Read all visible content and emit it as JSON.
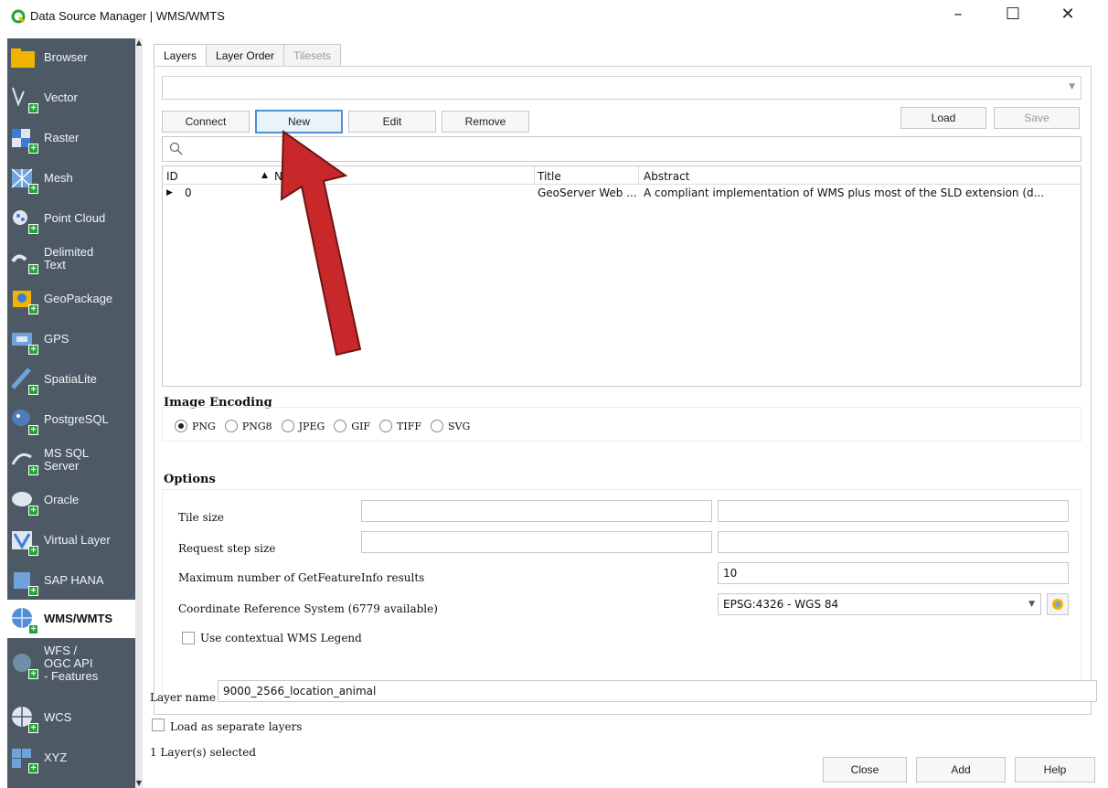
{
  "window": {
    "title": "Data Source Manager | WMS/WMTS",
    "min_glyph": "–",
    "max_glyph": "☐",
    "close_glyph": "✕"
  },
  "sidebar": {
    "items": [
      {
        "label": "Browser",
        "icon": "browser-folder-icon"
      },
      {
        "label": "Vector",
        "icon": "vector-layer-icon"
      },
      {
        "label": "Raster",
        "icon": "raster-layer-icon"
      },
      {
        "label": "Mesh",
        "icon": "mesh-layer-icon"
      },
      {
        "label": "Point Cloud",
        "icon": "point-cloud-icon"
      },
      {
        "label": "Delimited Text",
        "icon": "delimited-text-icon"
      },
      {
        "label": "GeoPackage",
        "icon": "geopackage-icon"
      },
      {
        "label": "GPS",
        "icon": "gps-icon"
      },
      {
        "label": "SpatiaLite",
        "icon": "spatialite-icon"
      },
      {
        "label": "PostgreSQL",
        "icon": "postgresql-icon"
      },
      {
        "label": "MS SQL Server",
        "icon": "mssql-icon"
      },
      {
        "label": "Oracle",
        "icon": "oracle-icon"
      },
      {
        "label": "Virtual Layer",
        "icon": "virtual-layer-icon"
      },
      {
        "label": "SAP HANA",
        "icon": "sap-hana-icon"
      },
      {
        "label": "WMS/WMTS",
        "icon": "wms-globe-icon"
      },
      {
        "label": "WFS / OGC API - Features",
        "icon": "wfs-icon"
      },
      {
        "label": "WCS",
        "icon": "wcs-icon"
      },
      {
        "label": "XYZ",
        "icon": "xyz-icon"
      }
    ],
    "active": "WMS/WMTS"
  },
  "tabs": [
    {
      "label": "Layers",
      "state": "active"
    },
    {
      "label": "Layer Order",
      "state": "normal"
    },
    {
      "label": "Tilesets",
      "state": "disabled"
    }
  ],
  "connection": {
    "selected": "",
    "connect_label": "Connect",
    "new_label": "New",
    "edit_label": "Edit",
    "remove_label": "Remove",
    "load_label": "Load",
    "save_label": "Save"
  },
  "search": {
    "placeholder": ""
  },
  "layers_table": {
    "columns": [
      "ID",
      "Na",
      "Title",
      "Abstract"
    ],
    "rows": [
      {
        "id": "0",
        "name": "",
        "title": "GeoServer Web ...",
        "abstract": "A compliant implementation of WMS plus most of the SLD extension (d..."
      }
    ]
  },
  "image_encoding": {
    "label": "Image Encoding",
    "options": [
      "PNG",
      "PNG8",
      "JPEG",
      "GIF",
      "TIFF",
      "SVG"
    ],
    "selected": "PNG"
  },
  "options": {
    "label": "Options",
    "tile_size_label": "Tile size",
    "tile_size_w": "",
    "tile_size_h": "",
    "request_step_label": "Request step size",
    "request_step_w": "",
    "request_step_h": "",
    "max_featureinfo_label": "Maximum number of GetFeatureInfo results",
    "max_featureinfo_value": "10",
    "crs_label": "Coordinate Reference System (6779 available)",
    "crs_value": "EPSG:4326 - WGS 84",
    "contextual_legend_label": "Use contextual WMS Legend",
    "contextual_legend_checked": false
  },
  "footer": {
    "layer_name_label": "Layer name",
    "layer_name_value": "9000_2566_location_animal",
    "load_separate_label": "Load as separate layers",
    "status": "1 Layer(s) selected",
    "close_label": "Close",
    "add_label": "Add",
    "help_label": "Help"
  },
  "colors": {
    "sidebar_bg": "#4d5a66",
    "annotation_arrow": "#c8282a",
    "focus_border": "#4f8fd8",
    "qgis_green": "#27a23a"
  }
}
